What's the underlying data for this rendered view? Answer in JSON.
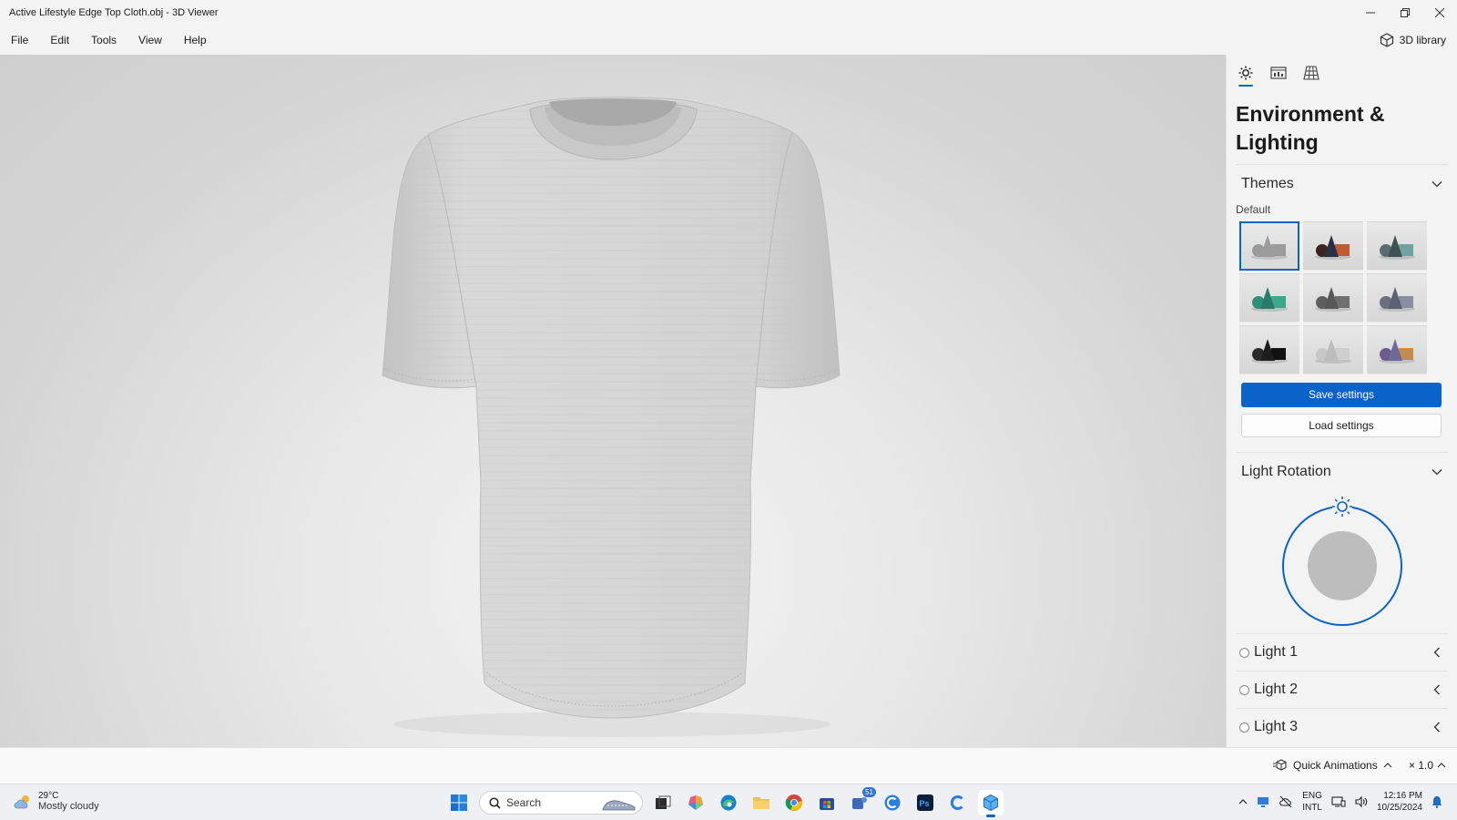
{
  "window": {
    "title": "Active Lifestyle Edge Top Cloth.obj - 3D Viewer"
  },
  "menu": {
    "items": [
      "File",
      "Edit",
      "Tools",
      "View",
      "Help"
    ],
    "library_label": "3D library"
  },
  "panel": {
    "title": "Environment & Lighting",
    "themes": {
      "label": "Themes",
      "sublabel": "Default",
      "tiles": [
        {
          "sphere": "#9b9b9b",
          "cone": "#9b9b9b",
          "box": "#9b9b9b"
        },
        {
          "sphere": "#3c2420",
          "cone": "#2a2f45",
          "box": "#c05a32"
        },
        {
          "sphere": "#566f6e",
          "cone": "#3c5352",
          "box": "#6fa3a1"
        },
        {
          "sphere": "#2d8f7a",
          "cone": "#2a7a69",
          "box": "#3ba88f"
        },
        {
          "sphere": "#5e5e5e",
          "cone": "#585858",
          "box": "#6f6f6f"
        },
        {
          "sphere": "#6a6f80",
          "cone": "#5d6175",
          "box": "#8b8ea0"
        },
        {
          "sphere": "#2a2a2a",
          "cone": "#1e1e1e",
          "box": "#111111"
        },
        {
          "sphere": "#c8c8c8",
          "cone": "#bdbdbd",
          "box": "#cfcfcf"
        },
        {
          "sphere": "#6c5a8c",
          "cone": "#6d6a9a",
          "box": "#c48a4e"
        }
      ],
      "save_label": "Save settings",
      "load_label": "Load settings"
    },
    "light_rotation": {
      "label": "Light Rotation"
    },
    "lights": [
      {
        "label": "Light 1"
      },
      {
        "label": "Light 2"
      },
      {
        "label": "Light 3"
      }
    ]
  },
  "statusbar": {
    "quick_animations": "Quick Animations",
    "speed": "× 1.0"
  },
  "taskbar": {
    "weather_temp": "29°C",
    "weather_desc": "Mostly cloudy",
    "search_placeholder": "Search",
    "badge_count": "51",
    "lang_1": "ENG",
    "lang_2": "INTL",
    "time": "12:16 PM",
    "date": "10/25/2024"
  },
  "colors": {
    "accent": "#0a63c9",
    "shirt": "#d2d2d2"
  }
}
